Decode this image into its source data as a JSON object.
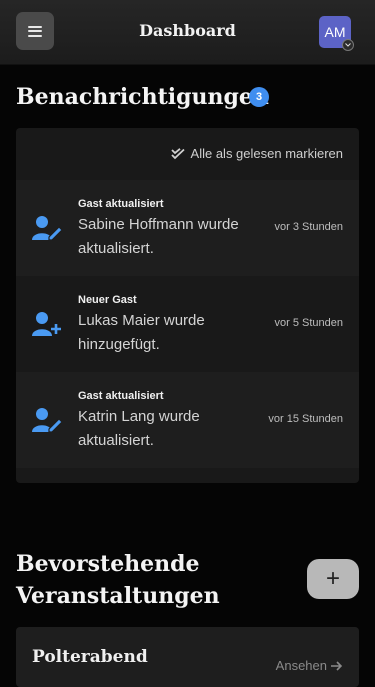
{
  "header": {
    "title": "Dashboard",
    "avatar_initials": "AM"
  },
  "notifications": {
    "title": "Benachrichtigungen",
    "count": "3",
    "mark_all_label": "Alle als gelesen markieren",
    "items": [
      {
        "type": "Gast aktualisiert",
        "message": "Sabine Hoffmann wurde aktualisiert.",
        "time": "vor 3 Stunden",
        "icon": "user-edit-icon"
      },
      {
        "type": "Neuer Gast",
        "message": "Lukas Maier wurde hinzugefügt.",
        "time": "vor 5 Stunden",
        "icon": "user-add-icon"
      },
      {
        "type": "Gast aktualisiert",
        "message": "Katrin Lang wurde aktualisiert.",
        "time": "vor 15 Stunden",
        "icon": "user-edit-icon"
      }
    ]
  },
  "events": {
    "title_line1": "Bevorstehende",
    "title_line2": "Veranstaltungen",
    "add_label": "+",
    "items": [
      {
        "name": "Polterabend",
        "link_label": "Ansehen"
      }
    ]
  },
  "colors": {
    "accent": "#3f8ef0",
    "avatar_bg": "#5c63c6"
  }
}
